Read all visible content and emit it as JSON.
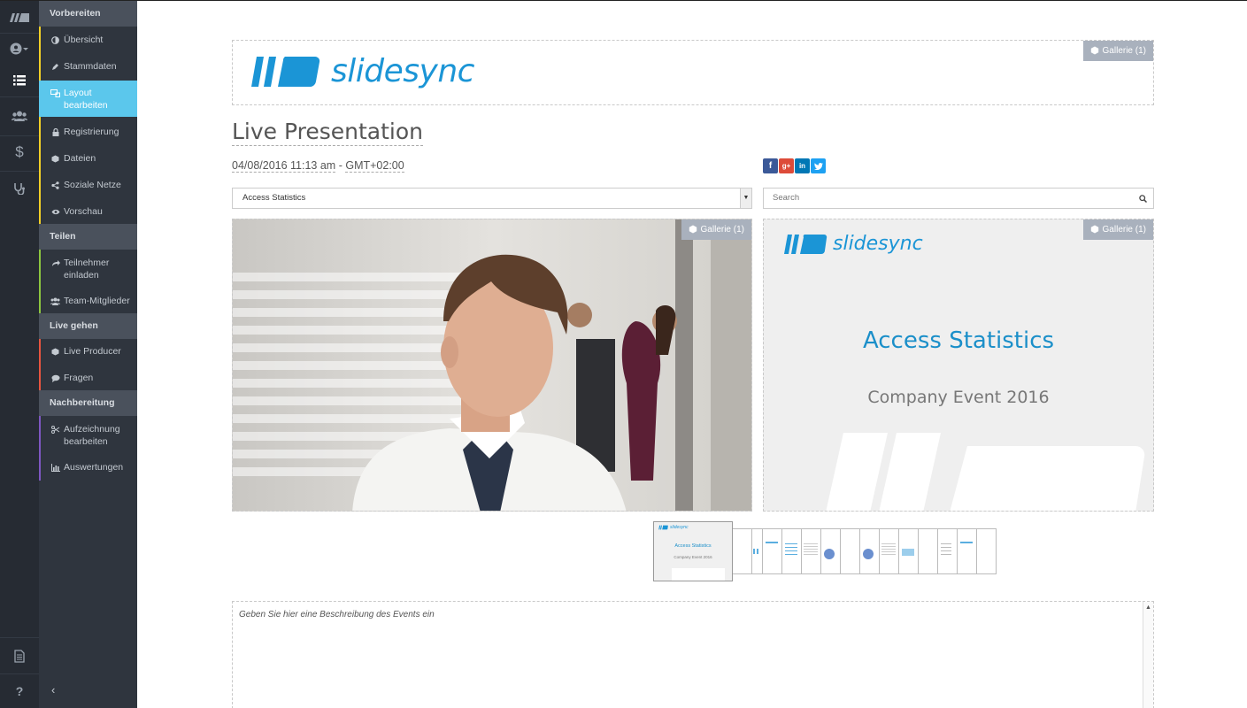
{
  "rail": {
    "items": [
      {
        "icon": "brand-logo-icon"
      },
      {
        "icon": "user-icon"
      },
      {
        "icon": "list-icon"
      },
      {
        "icon": "group-icon"
      },
      {
        "icon": "dollar-icon"
      },
      {
        "icon": "stethoscope-icon"
      }
    ],
    "bottom": [
      {
        "icon": "document-icon"
      },
      {
        "icon": "help-icon",
        "glyph": "?"
      },
      {
        "icon": "collapse-icon",
        "glyph": "‹"
      }
    ]
  },
  "sidebar": {
    "sections": [
      {
        "title": "Vorbereiten",
        "color": "#f2d027",
        "items": [
          {
            "label": "Übersicht",
            "icon": "half-circle-icon"
          },
          {
            "label": "Stammdaten",
            "icon": "pencil-icon"
          },
          {
            "label": "Layout bearbeiten",
            "icon": "layout-icon",
            "active": true
          },
          {
            "label": "Registrierung",
            "icon": "lock-icon"
          },
          {
            "label": "Dateien",
            "icon": "cube-icon"
          },
          {
            "label": "Soziale Netze",
            "icon": "share-icon"
          },
          {
            "label": "Vorschau",
            "icon": "eye-icon"
          }
        ]
      },
      {
        "title": "Teilen",
        "color": "#8cc63f",
        "items": [
          {
            "label": "Teilnehmer einladen",
            "icon": "share-arrow-icon"
          },
          {
            "label": "Team-Mitglieder",
            "icon": "users-icon"
          }
        ]
      },
      {
        "title": "Live gehen",
        "color": "#e8553f",
        "items": [
          {
            "label": "Live Producer",
            "icon": "cube-icon"
          },
          {
            "label": "Fragen",
            "icon": "comment-icon"
          }
        ]
      },
      {
        "title": "Nachbereitung",
        "color": "#7e57c2",
        "items": [
          {
            "label": "Aufzeichnung bearbeiten",
            "icon": "scissors-icon"
          },
          {
            "label": "Auswertungen",
            "icon": "bar-chart-icon"
          }
        ]
      }
    ]
  },
  "main": {
    "logo_text": "slidesync",
    "gallery_label": "Gallerie (1)",
    "title": "Live Presentation",
    "date": "04/08/2016 11:13 am",
    "timezone": "GMT+02:00",
    "date_separator": " - ",
    "social": [
      {
        "icon": "facebook-icon",
        "glyph": "f",
        "color": "#3b5998"
      },
      {
        "icon": "google-plus-icon",
        "glyph": "g+",
        "color": "#dd4b39"
      },
      {
        "icon": "linkedin-icon",
        "glyph": "in",
        "color": "#0077b5"
      },
      {
        "icon": "twitter-icon",
        "glyph": "t",
        "color": "#1da1f2"
      }
    ],
    "select_value": "Access Statistics",
    "search_placeholder": "Search",
    "slide": {
      "logo_text": "slidesync",
      "title": "Access Statistics",
      "subtitle": "Company Event 2016"
    },
    "thumb_main": {
      "logo_text": "slidesync",
      "title": "Access Statistics",
      "subtitle": "Company Event 2016"
    },
    "description_placeholder": "Geben Sie hier eine Beschreibung des Events ein"
  },
  "colors": {
    "accent": "#5bc7ec",
    "brand_blue": "#1b95d6",
    "slide_title": "#1b8fc9"
  }
}
